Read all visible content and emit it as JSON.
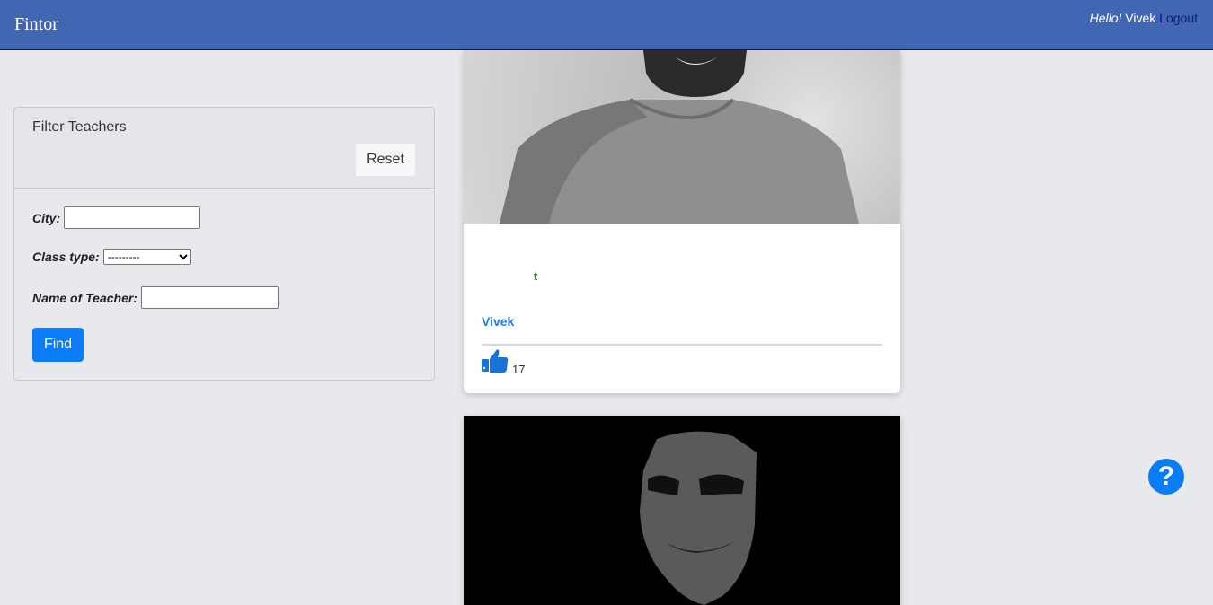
{
  "navbar": {
    "brand": "Fintor",
    "hello": "Hello!",
    "username": "Vivek",
    "separator": ".",
    "logout": "Logout"
  },
  "filter": {
    "title": "Filter Teachers",
    "reset_label": "Reset",
    "city_label": "City:",
    "city_value": "",
    "class_type_label": "Class type:",
    "class_type_selected": "---------",
    "teacher_label": "Name of Teacher:",
    "teacher_value": "",
    "find_label": "Find"
  },
  "cards": [
    {
      "subtitle": "t",
      "name": "Vivek",
      "likes": "17",
      "image": "teacher-photo-grayscale"
    },
    {
      "image": "anonymous-mask-photo"
    }
  ],
  "help": {
    "icon": "help-icon",
    "glyph": "?"
  },
  "colors": {
    "navbar": "#4267b2",
    "accent": "#0a7cf7",
    "link": "#1e7de0",
    "subtitle": "#1c7d17"
  }
}
